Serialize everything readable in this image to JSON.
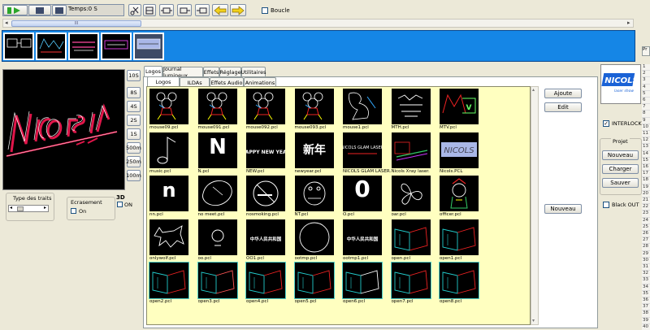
{
  "toolbar": {
    "time": "Temps:0 S",
    "loop_label": "Boucle"
  },
  "scroll_mark": "III",
  "speed_buttons": [
    "10S",
    "8S",
    "4S",
    "2S",
    "1S",
    "500m",
    "250m",
    "100m"
  ],
  "trait": {
    "group_label": "Type des traits"
  },
  "ecrasement": {
    "group_label": "Ecrasement",
    "checkbox_label": "On"
  },
  "three_d": {
    "label": "3D",
    "checkbox_label": "ON"
  },
  "main_tabs": [
    "Logos",
    "Journal lumineux",
    "Effets",
    "Réglage",
    "Utilitaires"
  ],
  "sub_tabs": [
    "Logos",
    "ILDAs",
    "Effets Audio",
    "Animations"
  ],
  "right_buttons": {
    "ajoute": "Ajoute",
    "edit": "Edit",
    "nouveau": "Nouveau"
  },
  "side": {
    "logo_text": "NICOLS",
    "logo_sub": "laser show",
    "interlock": "INTERLOCK",
    "projet_title": "Projet",
    "nouveau": "Nouveau",
    "charger": "Charger",
    "sauver": "Sauver",
    "blackout": "Black OUT",
    "far_right_tab": "Pr"
  },
  "row_numbers": [
    "1",
    "2",
    "3",
    "4",
    "5",
    "6",
    "7",
    "8",
    "9",
    "10",
    "11",
    "12",
    "13",
    "14",
    "15",
    "16",
    "17",
    "18",
    "19",
    "20",
    "21",
    "22",
    "23",
    "24",
    "25",
    "26",
    "27",
    "28",
    "29",
    "30",
    "31",
    "32",
    "33",
    "34",
    "35",
    "36",
    "37",
    "38",
    "39",
    "40"
  ],
  "files": [
    [
      "mouse09.pcl",
      "mouse091.pcl",
      "mouse092.pcl",
      "mouse093.pcl",
      "mouse1.pcl",
      "MTH.pcl",
      "MTV.pcl"
    ],
    [
      "music.pcl",
      "N.pcl",
      "NEW.pcl",
      "newyear.pcl",
      "NICOLS GLAM LASER.",
      "Nicols Xray laser.",
      "Nicols.PCL"
    ],
    [
      "nn.pcl",
      "no meet.pcl",
      "nosmoking.pcl",
      "NT.pcl",
      "O.pcl",
      "oar.pcl",
      "officer.pcl"
    ],
    [
      "onlywolf.pcl",
      "oo.pcl",
      "OO1.pcl",
      "ootmp.pcl",
      "ootmp1.pcl",
      "open.pcl",
      "open1.pcl"
    ],
    [
      "open2.pcl",
      "open3.pcl",
      "open4.pcl",
      "open5.pcl",
      "open6.pcl",
      "open7.pcl",
      "open8.pcl"
    ]
  ],
  "thumb_text": {
    "N": "N",
    "happy": "HAPPY NEW YEAR",
    "newyear": "新年",
    "glam": "NICOLS GLAM LASER",
    "nn": "n",
    "O": "0",
    "oo1": "中华人民共和国",
    "ootmp1": "中华人民共和国"
  }
}
